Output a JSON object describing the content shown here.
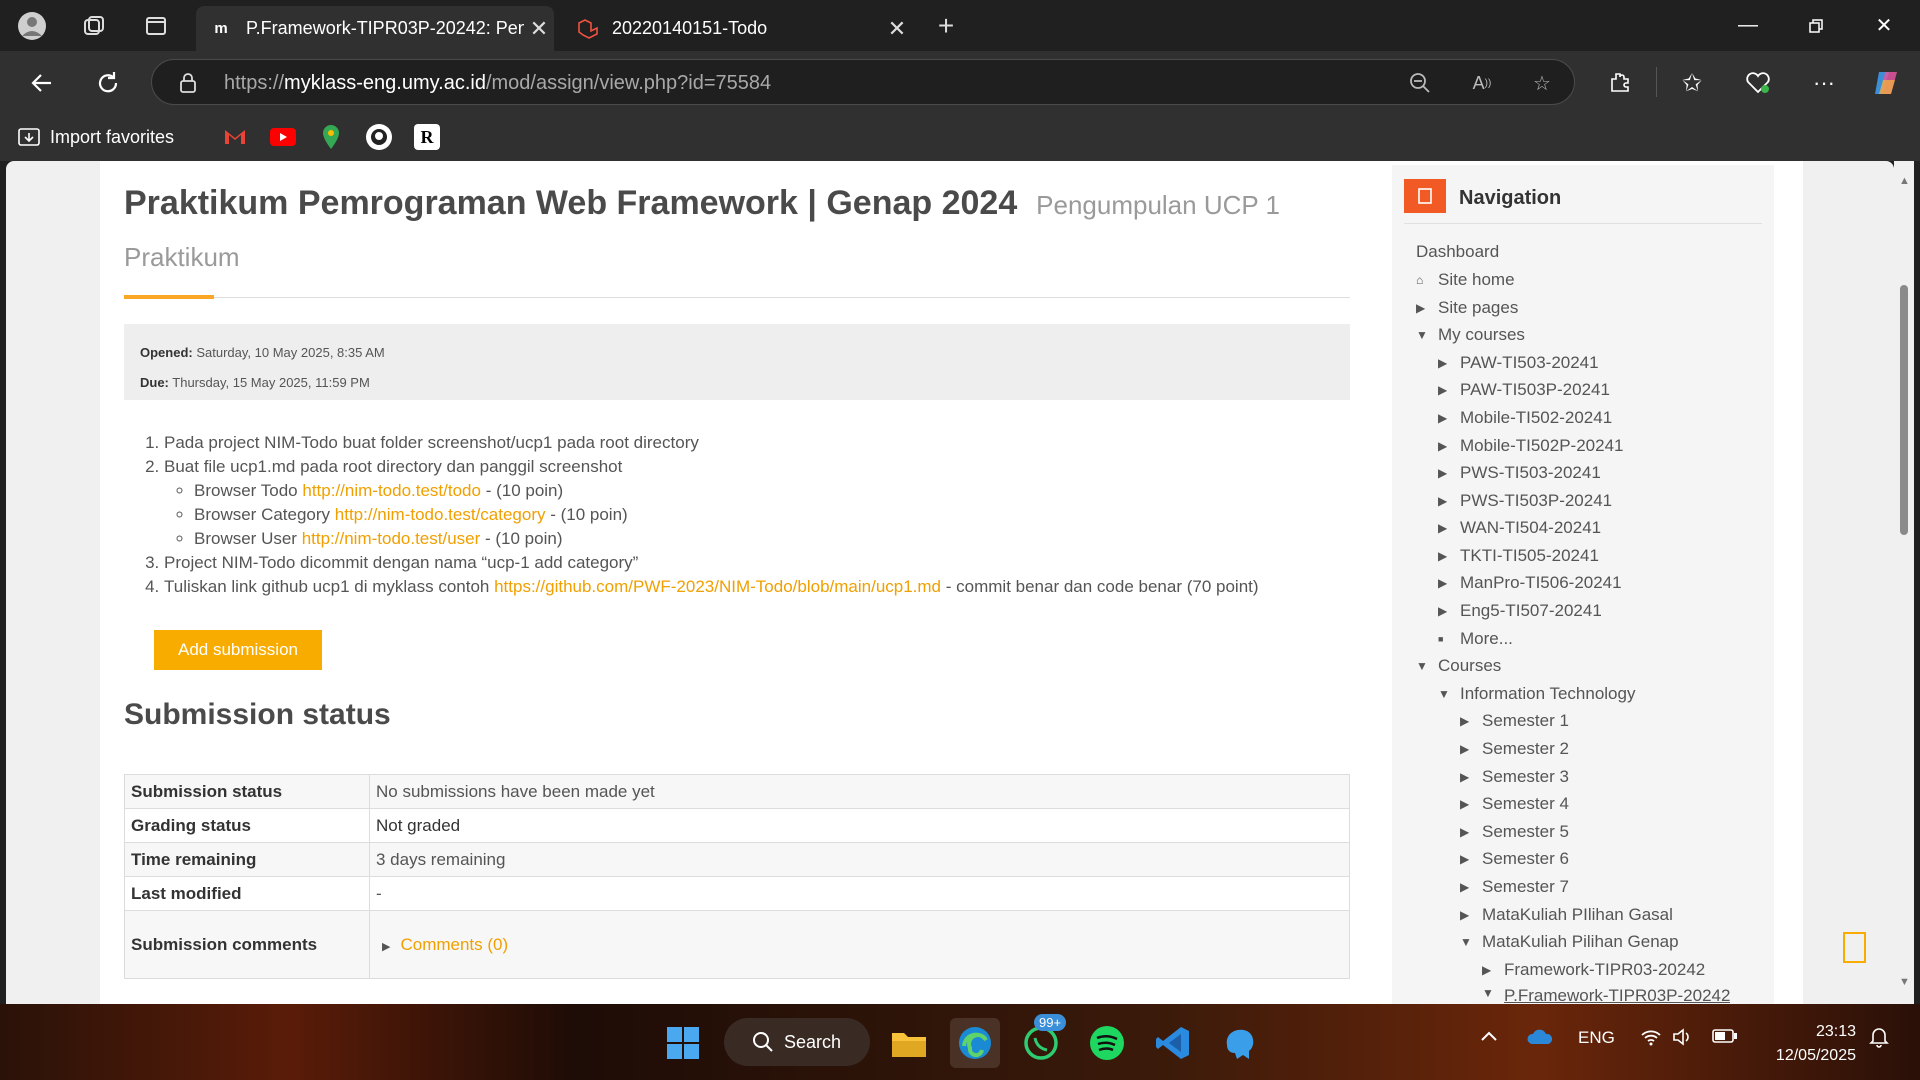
{
  "browser": {
    "tabs": [
      {
        "title": "P.Framework-TIPR03P-20242: Pen",
        "favicon": "m-logo",
        "active": true
      },
      {
        "title": "20220140151-Todo",
        "favicon": "laravel-logo",
        "active": false
      }
    ],
    "address": {
      "prefix": "https://",
      "host": "myklass-eng.umy.ac.id",
      "path": "/mod/assign/view.php?id=75584"
    },
    "bookmarks": {
      "import_label": "Import favorites",
      "icons": [
        "gmail-icon",
        "youtube-icon",
        "maps-icon",
        "github-icon",
        "r-icon"
      ]
    }
  },
  "page": {
    "course_title": "Praktikum Pemrograman Web Framework | Genap 2024",
    "activity_title": "Pengumpulan UCP 1 Praktikum",
    "dates": {
      "opened_label": "Opened:",
      "opened_value": "Saturday, 10 May 2025, 8:35 AM",
      "due_label": "Due:",
      "due_value": "Thursday, 15 May 2025, 11:59 PM"
    },
    "intro": {
      "item1": "Pada project NIM-Todo buat folder screenshot/ucp1 pada root directory",
      "item2": "Buat file ucp1.md pada root directory dan panggil screenshot",
      "sub1_text": "Browser Todo ",
      "sub1_link": "http://nim-todo.test/todo",
      "sub1_suffix": " - (10 poin)",
      "sub2_text": "Browser Category ",
      "sub2_link": "http://nim-todo.test/category",
      "sub2_suffix": " - (10 poin)",
      "sub3_text": "Browser User ",
      "sub3_link": "http://nim-todo.test/user",
      "sub3_suffix": " - (10 poin)",
      "item3": "Project NIM-Todo dicommit dengan nama “ucp-1 add category”",
      "item4_text": "Tuliskan link github ucp1 di myklass contoh ",
      "item4_link": "https://github.com/PWF-2023/NIM-Todo/blob/main/ucp1.md",
      "item4_suffix": " - commit benar dan code benar (70 point)"
    },
    "add_submission": "Add submission",
    "submission_heading": "Submission status",
    "status_rows": [
      {
        "label": "Submission status",
        "value": "No submissions have been made yet"
      },
      {
        "label": "Grading status",
        "value": "Not graded"
      },
      {
        "label": "Time remaining",
        "value": "3 days remaining"
      },
      {
        "label": "Last modified",
        "value": "-"
      },
      {
        "label": "Submission comments",
        "value": "Comments (0)"
      }
    ]
  },
  "navigation": {
    "title": "Navigation",
    "items": [
      "Dashboard",
      "Site home",
      "Site pages",
      "My courses",
      "PAW-TI503-20241",
      "PAW-TI503P-20241",
      "Mobile-TI502-20241",
      "Mobile-TI502P-20241",
      "PWS-TI503-20241",
      "PWS-TI503P-20241",
      "WAN-TI504-20241",
      "TKTI-TI505-20241",
      "ManPro-TI506-20241",
      "Eng5-TI507-20241",
      "More...",
      "Courses",
      "Information Technology",
      "Semester 1",
      "Semester 2",
      "Semester 3",
      "Semester 4",
      "Semester 5",
      "Semester 6",
      "Semester 7",
      "MataKuliah PIlihan Gasal",
      "MataKuliah Pilihan Genap",
      "Framework-TIPR03-20242",
      "P.Framework-TIPR03P-20242"
    ]
  },
  "taskbar": {
    "search_label": "Search",
    "badge": "99+",
    "language": "ENG",
    "time": "23:13",
    "date": "12/05/2025"
  },
  "colors": {
    "accent": "#f9ac00",
    "nav_icon": "#f15a24",
    "link": "#f0a000"
  }
}
